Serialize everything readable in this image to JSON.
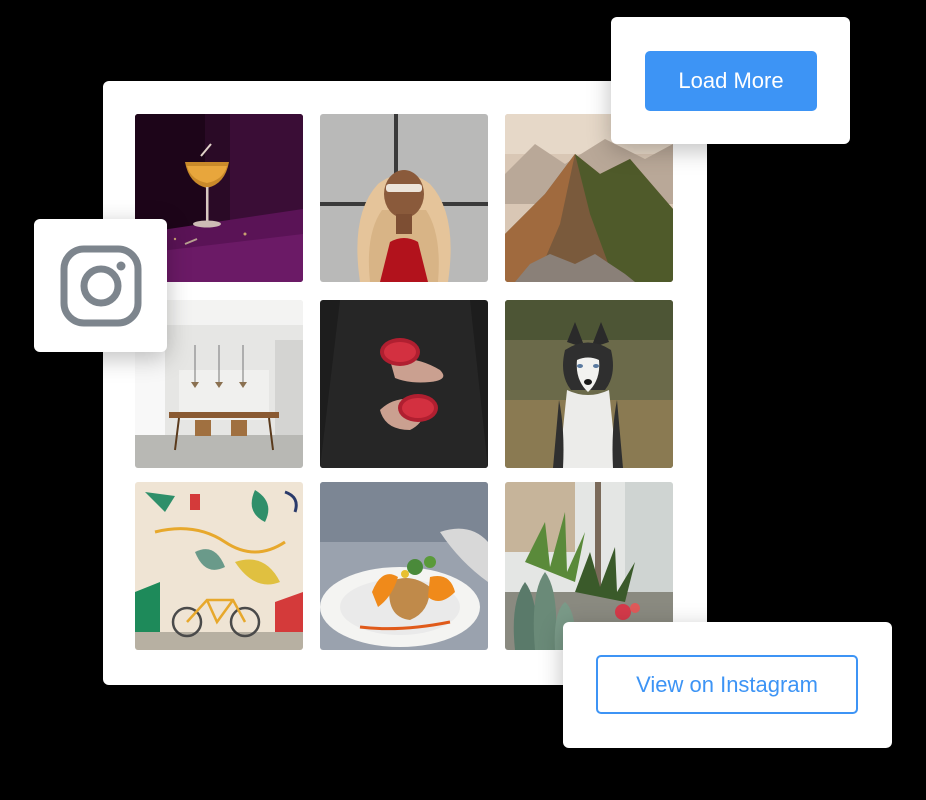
{
  "buttons": {
    "load_more": "Load More",
    "view_on_instagram": "View on Instagram"
  },
  "icons": {
    "brand": "instagram-icon"
  },
  "colors": {
    "accent": "#3d94f5",
    "background": "#000000",
    "card": "#ffffff",
    "icon": "#7d858d"
  },
  "gallery": {
    "tiles": [
      {
        "subject": "cocktail-glass"
      },
      {
        "subject": "woman-portrait"
      },
      {
        "subject": "mountain-ridge"
      },
      {
        "subject": "dining-room"
      },
      {
        "subject": "hands-holding-fruit"
      },
      {
        "subject": "husky-dog"
      },
      {
        "subject": "mural-bicycle"
      },
      {
        "subject": "plated-food"
      },
      {
        "subject": "cactus-plants"
      }
    ]
  }
}
